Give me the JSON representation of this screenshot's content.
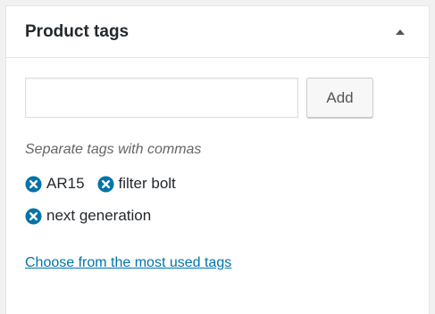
{
  "panel": {
    "title": "Product tags"
  },
  "add_tag": {
    "input_value": "",
    "button_label": "Add"
  },
  "hint": "Separate tags with commas",
  "tags": [
    {
      "label": "AR15"
    },
    {
      "label": "filter bolt"
    },
    {
      "label": "next generation"
    }
  ],
  "most_used_link": "Choose from the most used tags",
  "colors": {
    "remove_icon": "#0073aa",
    "link": "#0073aa",
    "toggle_arrow": "#555555"
  },
  "icons": {
    "toggle": "triangle-up-icon",
    "remove": "remove-circle-x-icon"
  }
}
